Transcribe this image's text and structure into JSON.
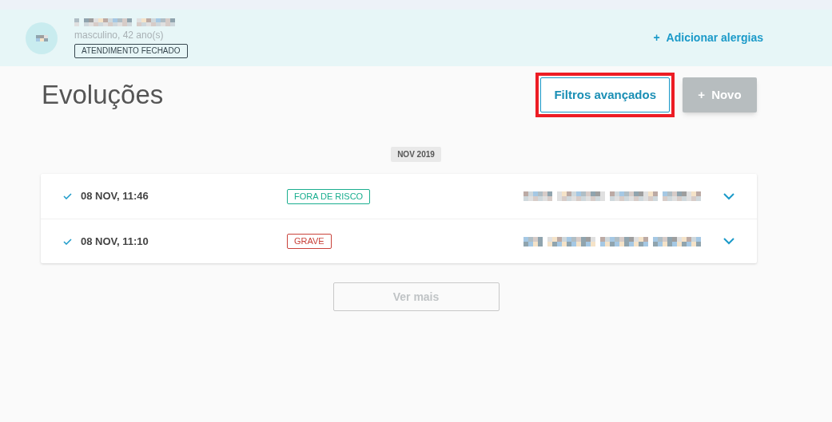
{
  "patient": {
    "details": "masculino, 42 ano(s)",
    "status_badge": "ATENDIMENTO FECHADO",
    "add_allergies": {
      "icon": "+",
      "label": "Adicionar alergias"
    }
  },
  "page": {
    "title": "Evoluções",
    "filters_button": {
      "label": "Filtros avançados",
      "highlighted": true
    },
    "new_button": {
      "icon": "+",
      "label": "Novo",
      "disabled": true
    }
  },
  "month_label": "NOV 2019",
  "entries": [
    {
      "datetime": "08 NOV, 11:46",
      "status": "FORA DE RISCO",
      "color": "#1aae8f",
      "expanded": false
    },
    {
      "datetime": "08 NOV, 11:10",
      "status": "GRAVE",
      "color": "#c9423a",
      "expanded": false
    }
  ],
  "more_button": {
    "label": "Ver mais",
    "disabled": true
  }
}
